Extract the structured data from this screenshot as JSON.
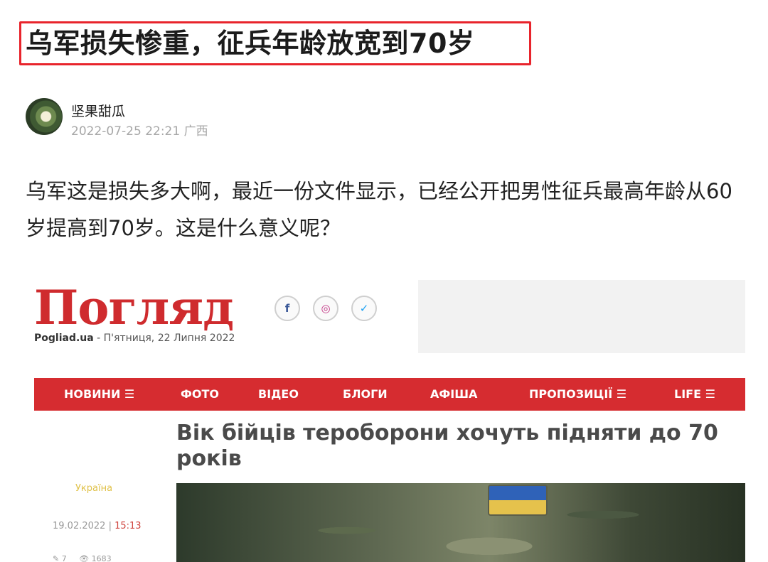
{
  "article": {
    "title": "乌军损失惨重，征兵年龄放宽到70岁",
    "author": "坚果甜瓜",
    "meta": "2022-07-25 22:21 广西",
    "body": "乌军这是损失多大啊，最近一份文件显示，已经公开把男性征兵最高年龄从60岁提高到70岁。这是什么意义呢？"
  },
  "embed": {
    "logo": "Погляд",
    "site": "Pogliad.ua",
    "date_line": " - П'ятниця, 22 Липня 2022",
    "social_icons": [
      "facebook-icon",
      "instagram-icon",
      "twitter-icon"
    ],
    "nav": [
      "НОВИНИ ☰",
      "ФОТО",
      "ВІДЕО",
      "БЛОГИ",
      "АФІША",
      "ПРОПОЗИЦІЇ ☰",
      "LIFE ☰"
    ],
    "headline": "Вік бійців тероборони хочуть підняти до 70 років",
    "category": "Україна",
    "date": "19.02.2022",
    "time": "15:13",
    "comments": "7",
    "views": "1683"
  },
  "colors": {
    "title_border": "#e8242c",
    "nav_bg": "#d62c30",
    "logo": "#cf2b2e"
  }
}
